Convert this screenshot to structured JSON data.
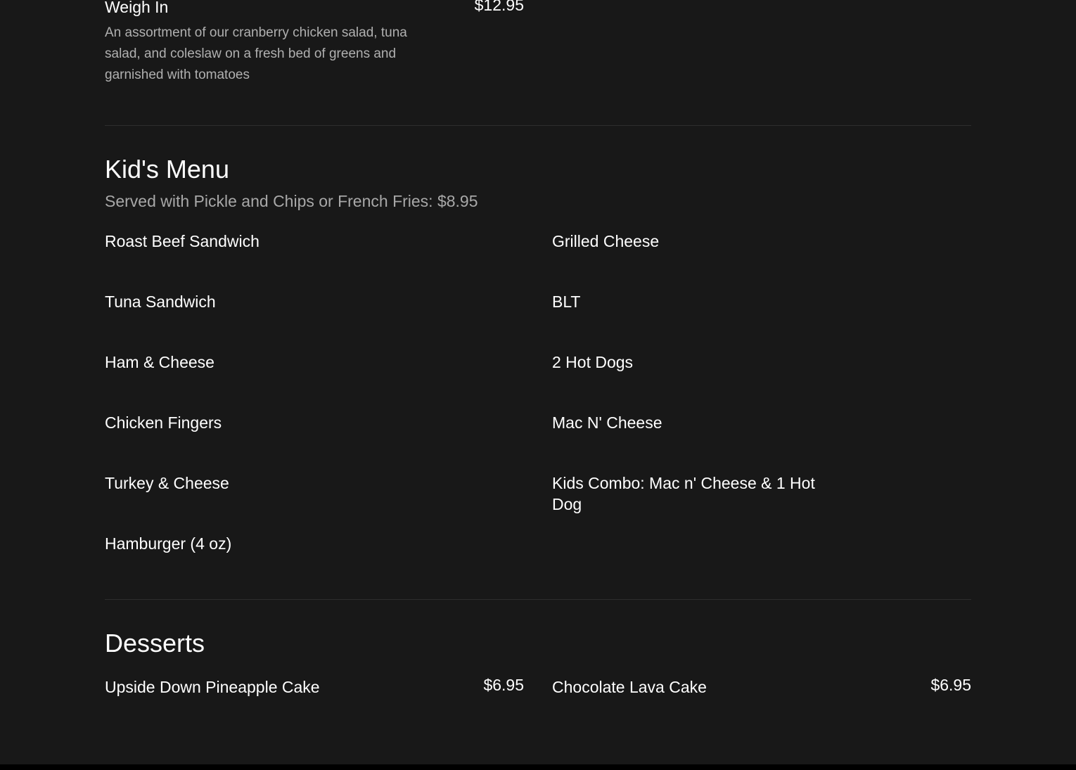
{
  "salads": {
    "item": {
      "name": "Weigh In",
      "price": "$12.95",
      "description": "An assortment of our cranberry chicken salad, tuna salad, and coleslaw on a fresh bed of greens and garnished with tomatoes"
    }
  },
  "kids_menu": {
    "title": "Kid's Menu",
    "subtitle": "Served with Pickle and Chips or French Fries: $8.95",
    "left_items": [
      "Roast Beef Sandwich",
      "Tuna Sandwich",
      "Ham & Cheese",
      "Chicken Fingers",
      "Turkey & Cheese",
      "Hamburger (4 oz)"
    ],
    "right_items": [
      "Grilled Cheese",
      "BLT",
      "2 Hot Dogs",
      "Mac N' Cheese",
      "Kids Combo: Mac n' Cheese & 1 Hot Dog"
    ]
  },
  "desserts": {
    "title": "Desserts",
    "items": [
      {
        "name": "Upside Down Pineapple Cake",
        "price": "$6.95"
      },
      {
        "name": "Chocolate Lava Cake",
        "price": "$6.95"
      }
    ]
  }
}
